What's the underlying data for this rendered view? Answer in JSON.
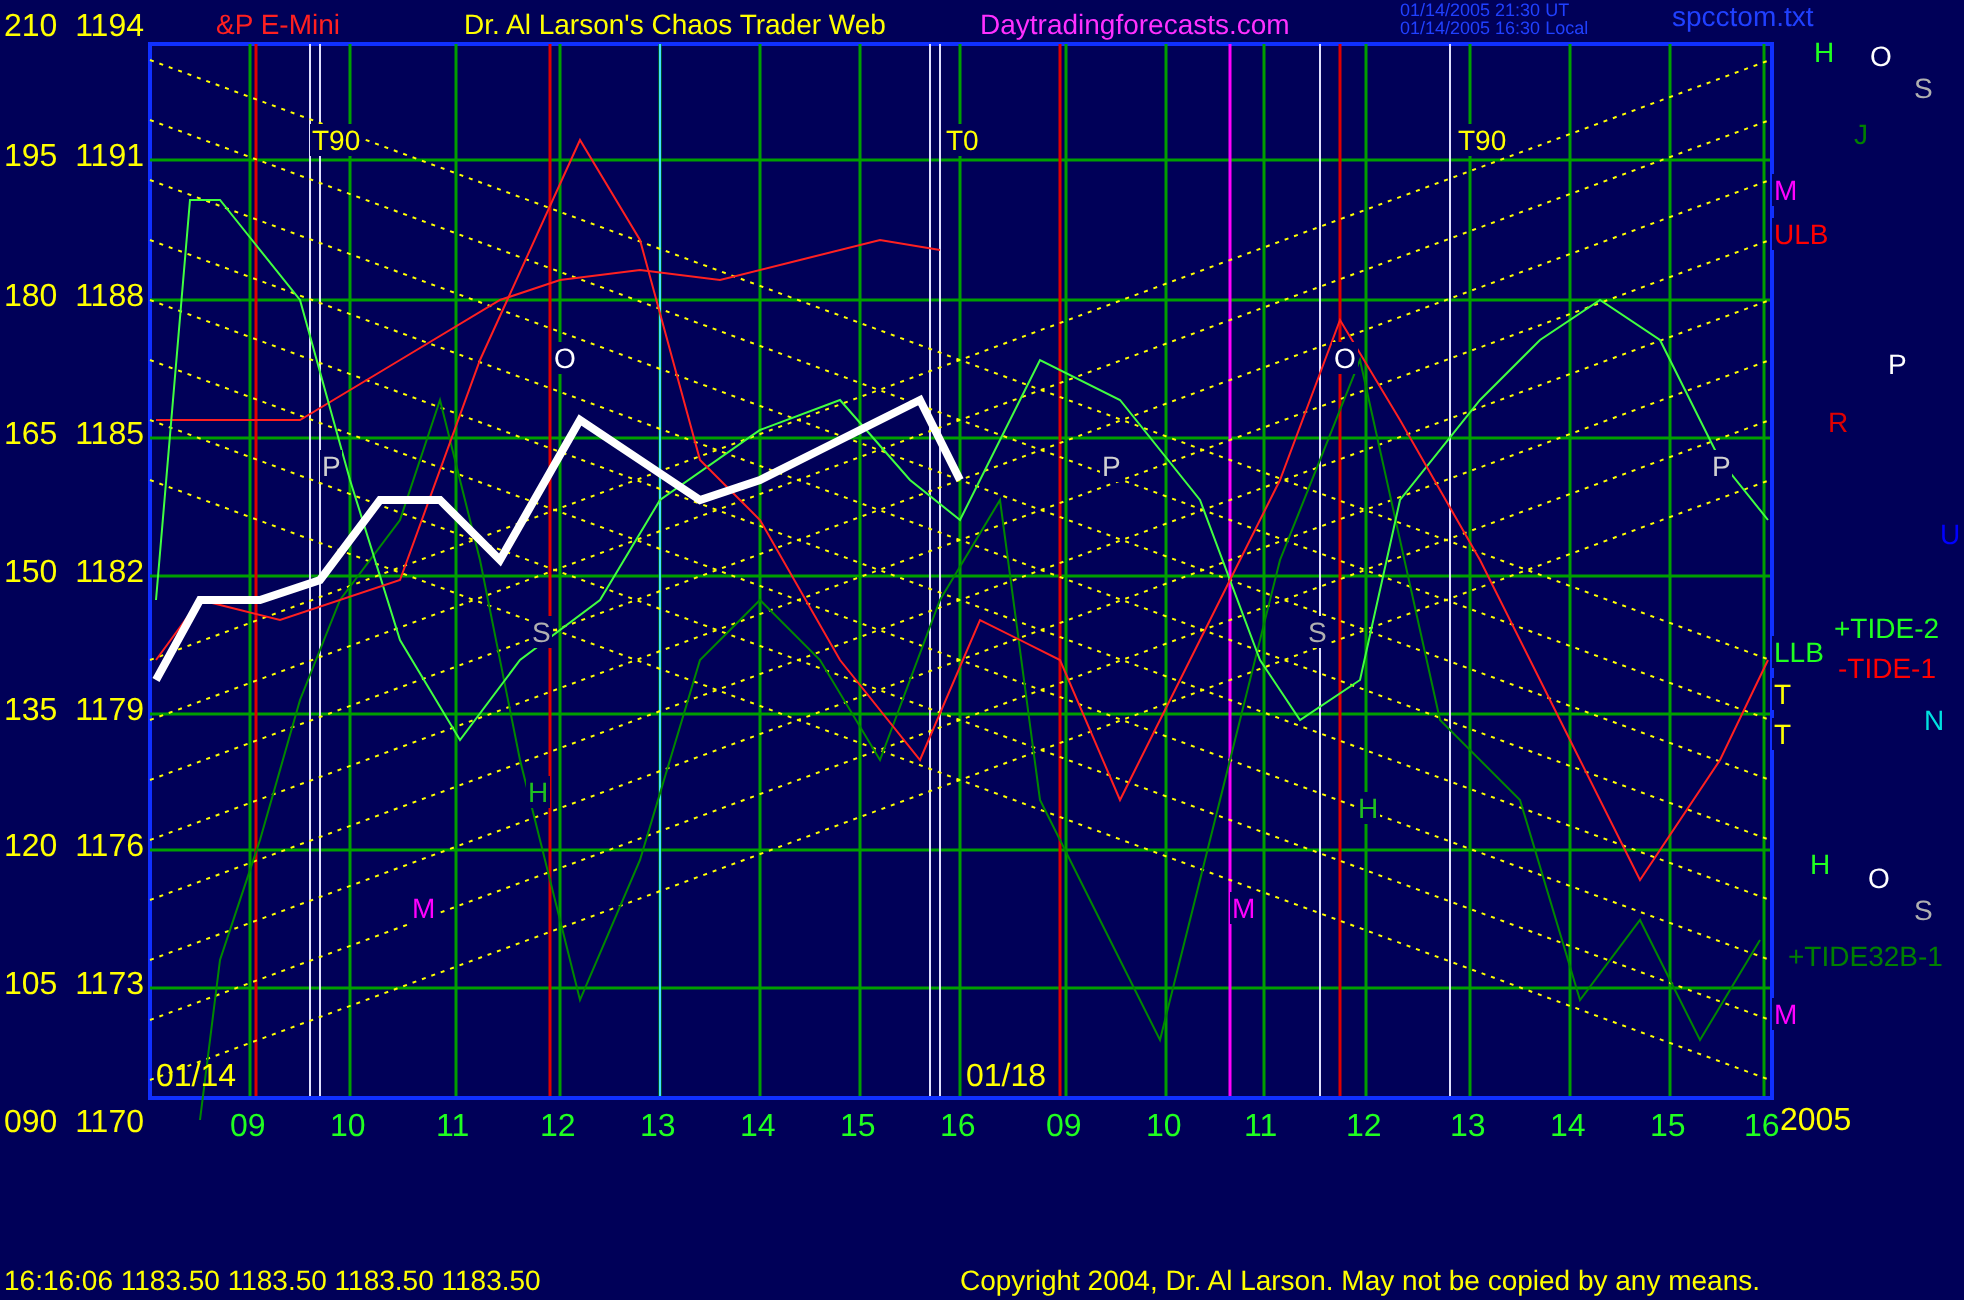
{
  "header": {
    "instrument": "&P E-Mini",
    "title": "Dr. Al Larson's Chaos Trader Web",
    "site": "Daytradingforecasts.com",
    "timestamps": [
      "01/14/2005 21:30 UT",
      "01/14/2005 16:30 Local"
    ],
    "file": "spcctom.txt"
  },
  "price_axis": [
    {
      "cycle": "210",
      "price": "1194"
    },
    {
      "cycle": "195",
      "price": "1191"
    },
    {
      "cycle": "180",
      "price": "1188"
    },
    {
      "cycle": "165",
      "price": "1185"
    },
    {
      "cycle": "150",
      "price": "1182"
    },
    {
      "cycle": "135",
      "price": "1179"
    },
    {
      "cycle": "120",
      "price": "1176"
    },
    {
      "cycle": "105",
      "price": "1173"
    },
    {
      "cycle": "090",
      "price": "1170"
    }
  ],
  "time_axis": [
    "09",
    "10",
    "11",
    "12",
    "13",
    "14",
    "15",
    "16",
    "09",
    "10",
    "11",
    "12",
    "13",
    "14",
    "15",
    "16"
  ],
  "date_labels": [
    "01/14",
    "01/18",
    "2005"
  ],
  "markers": [
    {
      "text": "T90",
      "color": "#ffff00"
    },
    {
      "text": "T0",
      "color": "#ffff00"
    },
    {
      "text": "T90",
      "color": "#ffff00"
    },
    {
      "text": "O",
      "color": "#ffffff"
    },
    {
      "text": "O",
      "color": "#ffffff"
    },
    {
      "text": "P",
      "color": "#d0d0d0"
    },
    {
      "text": "P",
      "color": "#d0d0d0"
    },
    {
      "text": "P",
      "color": "#d0d0d0"
    },
    {
      "text": "S",
      "color": "#b0b0b0"
    },
    {
      "text": "S",
      "color": "#b0b0b0"
    },
    {
      "text": "H",
      "color": "#20c020"
    },
    {
      "text": "H",
      "color": "#20c020"
    },
    {
      "text": "M",
      "color": "#ff00ff"
    },
    {
      "text": "M",
      "color": "#ff00ff"
    },
    {
      "text": "H",
      "color": "#20ff20"
    },
    {
      "text": "O",
      "color": "#ffffff"
    },
    {
      "text": "S",
      "color": "#b0b0b0"
    },
    {
      "text": "J",
      "color": "#008000"
    },
    {
      "text": "M",
      "color": "#ff00ff"
    },
    {
      "text": "ULB",
      "color": "#ff0000"
    },
    {
      "text": "P",
      "color": "#ffffff"
    },
    {
      "text": "R",
      "color": "#e00000"
    },
    {
      "text": "U",
      "color": "#0000ff"
    },
    {
      "text": "+TIDE-2",
      "color": "#20ff20"
    },
    {
      "text": "LLB",
      "color": "#20ff20"
    },
    {
      "text": "-TIDE-1",
      "color": "#ff0000"
    },
    {
      "text": "T",
      "color": "#ffff00"
    },
    {
      "text": "N",
      "color": "#00e0e0"
    },
    {
      "text": "T",
      "color": "#ffff00"
    },
    {
      "text": "H",
      "color": "#20ff20"
    },
    {
      "text": "O",
      "color": "#ffffff"
    },
    {
      "text": "S",
      "color": "#b0b0b0"
    },
    {
      "text": "+TIDE32B-1",
      "color": "#008000"
    },
    {
      "text": "M",
      "color": "#ff00ff"
    }
  ],
  "status_bar": {
    "quote": "16:16:06  1183.50 1183.50 1183.50 1183.50",
    "copyright": "Copyright 2004, Dr. Al Larson. May not be copied by any means."
  }
}
